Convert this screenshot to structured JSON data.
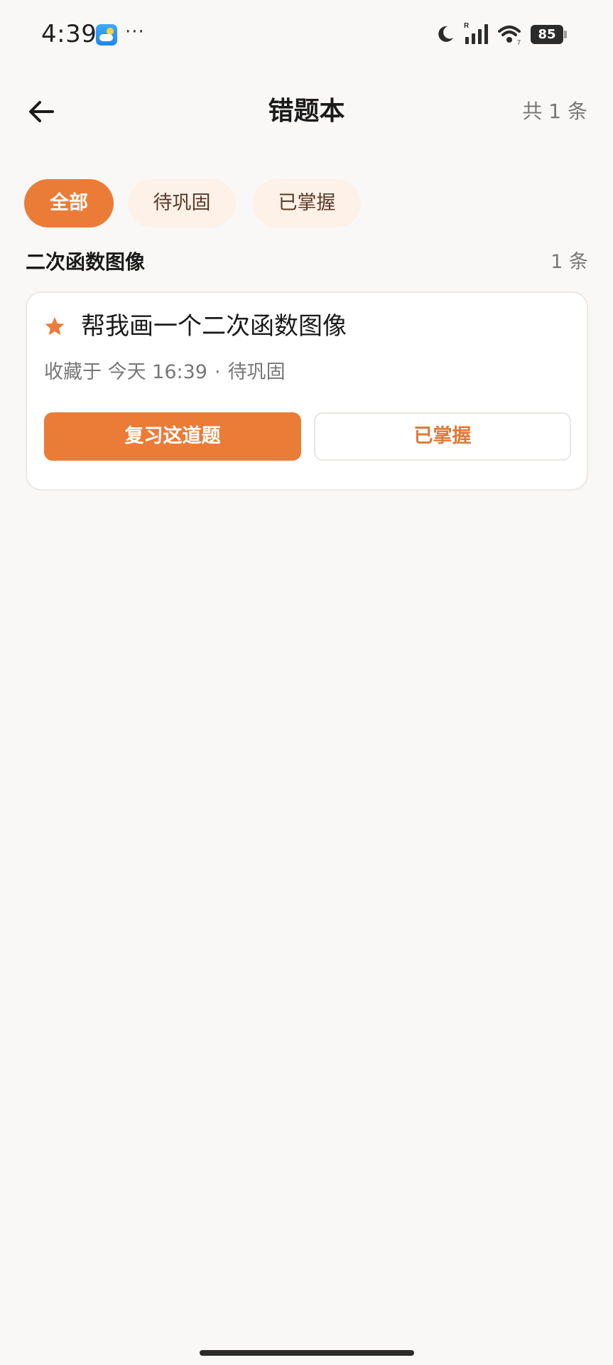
{
  "status_bar": {
    "time": "4:39",
    "more": "···",
    "battery": "85",
    "icons": [
      "weather-icon",
      "moon-icon",
      "signal-icon",
      "wifi-icon",
      "battery-icon"
    ]
  },
  "header": {
    "title": "错题本",
    "total": "共 1 条",
    "back_icon": "arrow-left-icon"
  },
  "tabs": [
    {
      "label": "全部",
      "active": true
    },
    {
      "label": "待巩固",
      "active": false
    },
    {
      "label": "已掌握",
      "active": false
    }
  ],
  "section": {
    "title": "二次函数图像",
    "count": "1 条"
  },
  "card": {
    "title": "帮我画一个二次函数图像",
    "meta_saved": "收藏于 今天 16:39",
    "meta_sep": "·",
    "meta_status": "待巩固",
    "review_label": "复习这道题",
    "mastered_label": "已掌握"
  },
  "colors": {
    "accent": "#ea7c38",
    "tab_inactive_bg": "#fdf1e8",
    "background": "#f9f8f6"
  }
}
